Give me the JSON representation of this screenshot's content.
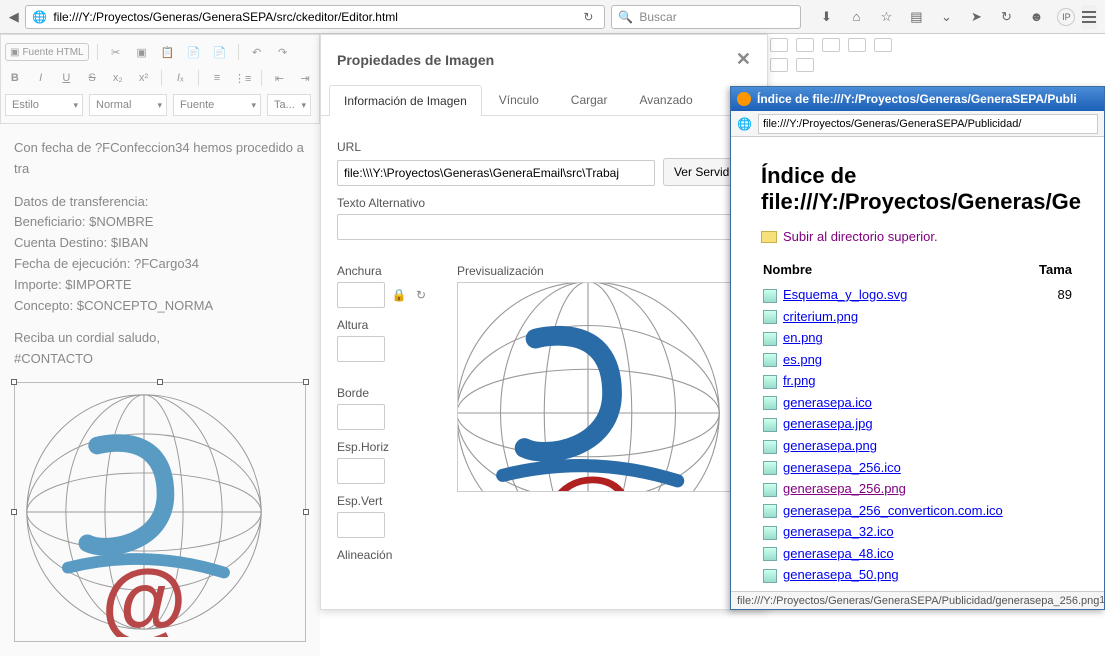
{
  "browser": {
    "url": "file:///Y:/Proyectos/Generas/GeneraSEPA/src/ckeditor/Editor.html",
    "search_placeholder": "Buscar"
  },
  "editor": {
    "source_btn": "Fuente HTML",
    "style_sel": "Estilo",
    "format_sel": "Normal",
    "font_sel": "Fuente",
    "size_sel": "Ta...",
    "content": {
      "line1": "Con fecha de ?FConfeccion34 hemos procedido a tra",
      "datos_title": "Datos de transferencia:",
      "beneficiario": "Beneficiario: $NOMBRE",
      "cuenta": "Cuenta Destino: $IBAN",
      "fecha_ejec": "Fecha de ejecución: ?FCargo34",
      "importe": "Importe: $IMPORTE",
      "concepto": "Concepto: $CONCEPTO_NORMA",
      "saludo": "Reciba un cordial saludo,",
      "contacto": "#CONTACTO"
    }
  },
  "dialog": {
    "title": "Propiedades de Imagen",
    "tabs": {
      "info": "Información de Imagen",
      "link": "Vínculo",
      "upload": "Cargar",
      "advanced": "Avanzado"
    },
    "url_label": "URL",
    "url_value": "file:\\\\\\Y:\\Proyectos\\Generas\\GeneraEmail\\src\\Trabaj",
    "browse_btn": "Ver Servidor",
    "alt_label": "Texto Alternativo",
    "width_label": "Anchura",
    "height_label": "Altura",
    "border_label": "Borde",
    "hspace_label": "Esp.Horiz",
    "vspace_label": "Esp.Vert",
    "align_label": "Alineación",
    "preview_label": "Previsualización"
  },
  "popup": {
    "title": "Índice de file:///Y:/Proyectos/Generas/GeneraSEPA/Publi",
    "addr": "file:///Y:/Proyectos/Generas/GeneraSEPA/Publicidad/",
    "heading": "Índice de file:///Y:/Proyectos/Generas/Ge",
    "up_link": "Subir al directorio superior.",
    "col_name": "Nombre",
    "col_size": "Tama",
    "files": [
      {
        "name": "Esquema_y_logo.svg",
        "size": "89"
      },
      {
        "name": "criterium.png",
        "size": ""
      },
      {
        "name": "en.png",
        "size": ""
      },
      {
        "name": "es.png",
        "size": ""
      },
      {
        "name": "fr.png",
        "size": ""
      },
      {
        "name": "generasepa.ico",
        "size": ""
      },
      {
        "name": "generasepa.jpg",
        "size": ""
      },
      {
        "name": "generasepa.png",
        "size": ""
      },
      {
        "name": "generasepa_256.ico",
        "size": ""
      },
      {
        "name": "generasepa_256.png",
        "size": "",
        "visited": true
      },
      {
        "name": "generasepa_256_converticon.com.ico",
        "size": ""
      },
      {
        "name": "generasepa_32.ico",
        "size": ""
      },
      {
        "name": "generasepa_48.ico",
        "size": ""
      },
      {
        "name": "generasepa_50.png",
        "size": ""
      }
    ],
    "status": "file:///Y:/Proyectos/Generas/GeneraSEPA/Publicidad/generasepa_256.png"
  }
}
